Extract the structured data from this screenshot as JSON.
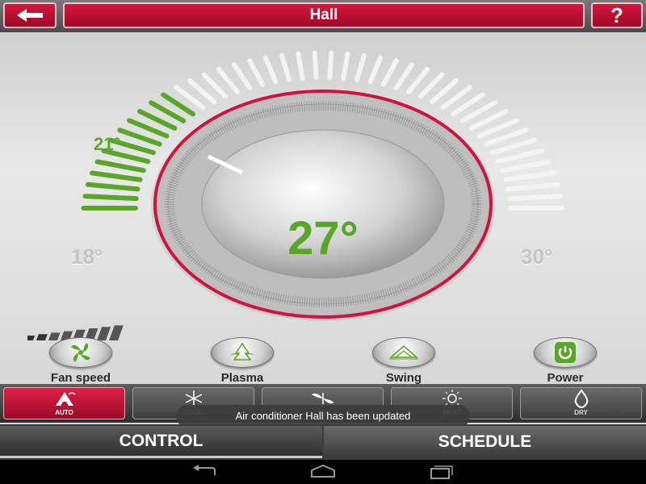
{
  "header": {
    "title": "Hall",
    "help_label": "?"
  },
  "thermostat": {
    "set_temp": "21°",
    "current_temp": "27°",
    "min_temp": "18°",
    "max_temp": "30°",
    "accent_color": "#cf1240",
    "green": "#5aa628"
  },
  "features": [
    {
      "label": "Fan speed",
      "icon": "fan-icon"
    },
    {
      "label": "Plasma",
      "icon": "plasma-icon"
    },
    {
      "label": "Swing",
      "icon": "swing-icon"
    },
    {
      "label": "Power",
      "icon": "power-icon"
    }
  ],
  "modes": [
    {
      "label": "AUTO",
      "icon": "auto-icon",
      "active": true
    },
    {
      "label": "COOL",
      "icon": "snowflake-icon",
      "active": false
    },
    {
      "label": "",
      "icon": "fan-blade-icon",
      "active": false
    },
    {
      "label": "HEAT",
      "icon": "sun-icon",
      "active": false
    },
    {
      "label": "DRY",
      "icon": "drop-icon",
      "active": false
    }
  ],
  "toast": "Air conditioner Hall has been updated",
  "tabs": {
    "control": "CONTROL",
    "schedule": "SCHEDULE"
  }
}
